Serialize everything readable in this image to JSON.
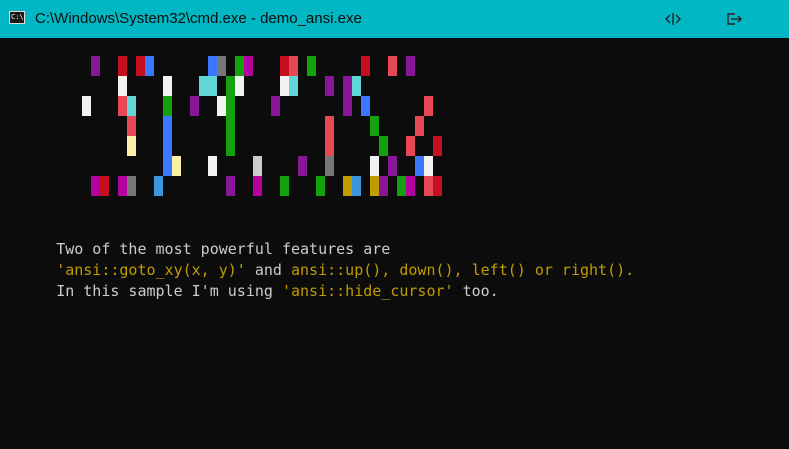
{
  "window": {
    "title": "C:\\Windows\\System32\\cmd.exe - demo_ansi.exe",
    "titlebar_color": "#00b7c3",
    "icons": [
      "cmd-app-icon",
      "resize-arrows-icon",
      "exit-icon"
    ],
    "app_icon_text": "C:\\"
  },
  "terminal": {
    "background": "#0c0c0c",
    "line1": [
      "Two of the most powerful features are"
    ],
    "line2": [
      "'ansi::goto_xy(x, y)'",
      " and ",
      "ansi::up(), down(), left() or right()."
    ],
    "line3": [
      "In this sample I'm using ",
      "'ansi::hide_cursor'",
      " too."
    ],
    "line1_colors": [
      "#cccccc"
    ],
    "line2_colors": [
      "#c19c00",
      "#cccccc",
      "#c19c00"
    ],
    "line3_colors": [
      "#cccccc",
      "#c19c00",
      "#cccccc"
    ]
  },
  "art": {
    "palette": {
      "P": "#881798",
      "R": "#c50f1f",
      "L": "#e74856",
      "B": "#3b78ff",
      "W": "#f2f2f2",
      "G": "#13a10e",
      "C": "#61d6d6",
      "Y": "#f9f1a5",
      "D": "#767676",
      "S": "#c19c00",
      "M": "#b4009e",
      "b": "#3a96dd",
      "g": "#cccccc"
    },
    "blocks": [
      {
        "row": 0,
        "col": 10,
        "color": "P"
      },
      {
        "row": 0,
        "col": 13,
        "color": "R"
      },
      {
        "row": 0,
        "col": 15,
        "color": "R"
      },
      {
        "row": 0,
        "col": 16,
        "color": "B"
      },
      {
        "row": 0,
        "col": 23,
        "color": "B"
      },
      {
        "row": 0,
        "col": 24,
        "color": "D"
      },
      {
        "row": 0,
        "col": 26,
        "color": "G"
      },
      {
        "row": 0,
        "col": 27,
        "color": "M"
      },
      {
        "row": 0,
        "col": 31,
        "color": "R"
      },
      {
        "row": 0,
        "col": 32,
        "color": "L"
      },
      {
        "row": 0,
        "col": 34,
        "color": "G"
      },
      {
        "row": 0,
        "col": 40,
        "color": "R"
      },
      {
        "row": 0,
        "col": 43,
        "color": "L"
      },
      {
        "row": 0,
        "col": 45,
        "color": "P"
      },
      {
        "row": 1,
        "col": 13,
        "color": "W"
      },
      {
        "row": 1,
        "col": 18,
        "color": "W"
      },
      {
        "row": 1,
        "col": 22,
        "color": "C"
      },
      {
        "row": 1,
        "col": 23,
        "color": "C"
      },
      {
        "row": 1,
        "col": 25,
        "color": "G"
      },
      {
        "row": 1,
        "col": 26,
        "color": "W"
      },
      {
        "row": 1,
        "col": 31,
        "color": "W"
      },
      {
        "row": 1,
        "col": 32,
        "color": "C"
      },
      {
        "row": 1,
        "col": 36,
        "color": "P"
      },
      {
        "row": 1,
        "col": 38,
        "color": "P"
      },
      {
        "row": 1,
        "col": 39,
        "color": "C"
      },
      {
        "row": 2,
        "col": 9,
        "color": "W"
      },
      {
        "row": 2,
        "col": 13,
        "color": "L"
      },
      {
        "row": 2,
        "col": 14,
        "color": "C"
      },
      {
        "row": 2,
        "col": 18,
        "color": "G"
      },
      {
        "row": 2,
        "col": 21,
        "color": "P"
      },
      {
        "row": 2,
        "col": 24,
        "color": "W"
      },
      {
        "row": 2,
        "col": 25,
        "color": "G"
      },
      {
        "row": 2,
        "col": 30,
        "color": "P"
      },
      {
        "row": 2,
        "col": 38,
        "color": "P"
      },
      {
        "row": 2,
        "col": 40,
        "color": "B"
      },
      {
        "row": 2,
        "col": 47,
        "color": "L"
      },
      {
        "row": 3,
        "col": 14,
        "color": "L"
      },
      {
        "row": 3,
        "col": 18,
        "color": "B"
      },
      {
        "row": 3,
        "col": 25,
        "color": "G"
      },
      {
        "row": 3,
        "col": 36,
        "color": "L"
      },
      {
        "row": 3,
        "col": 41,
        "color": "G"
      },
      {
        "row": 3,
        "col": 46,
        "color": "L"
      },
      {
        "row": 4,
        "col": 14,
        "color": "Y"
      },
      {
        "row": 4,
        "col": 18,
        "color": "B"
      },
      {
        "row": 4,
        "col": 25,
        "color": "G"
      },
      {
        "row": 4,
        "col": 36,
        "color": "L"
      },
      {
        "row": 4,
        "col": 42,
        "color": "G"
      },
      {
        "row": 4,
        "col": 45,
        "color": "L"
      },
      {
        "row": 4,
        "col": 48,
        "color": "R"
      },
      {
        "row": 5,
        "col": 18,
        "color": "B"
      },
      {
        "row": 5,
        "col": 19,
        "color": "Y"
      },
      {
        "row": 5,
        "col": 23,
        "color": "W"
      },
      {
        "row": 5,
        "col": 28,
        "color": "g"
      },
      {
        "row": 5,
        "col": 33,
        "color": "P"
      },
      {
        "row": 5,
        "col": 36,
        "color": "D"
      },
      {
        "row": 5,
        "col": 41,
        "color": "W"
      },
      {
        "row": 5,
        "col": 43,
        "color": "P"
      },
      {
        "row": 5,
        "col": 46,
        "color": "B"
      },
      {
        "row": 5,
        "col": 47,
        "color": "W"
      },
      {
        "row": 6,
        "col": 10,
        "color": "M"
      },
      {
        "row": 6,
        "col": 11,
        "color": "R"
      },
      {
        "row": 6,
        "col": 13,
        "color": "M"
      },
      {
        "row": 6,
        "col": 14,
        "color": "D"
      },
      {
        "row": 6,
        "col": 17,
        "color": "b"
      },
      {
        "row": 6,
        "col": 25,
        "color": "P"
      },
      {
        "row": 6,
        "col": 28,
        "color": "M"
      },
      {
        "row": 6,
        "col": 31,
        "color": "G"
      },
      {
        "row": 6,
        "col": 35,
        "color": "G"
      },
      {
        "row": 6,
        "col": 38,
        "color": "S"
      },
      {
        "row": 6,
        "col": 39,
        "color": "b"
      },
      {
        "row": 6,
        "col": 41,
        "color": "S"
      },
      {
        "row": 6,
        "col": 42,
        "color": "P"
      },
      {
        "row": 6,
        "col": 44,
        "color": "G"
      },
      {
        "row": 6,
        "col": 45,
        "color": "M"
      },
      {
        "row": 6,
        "col": 47,
        "color": "L"
      },
      {
        "row": 6,
        "col": 48,
        "color": "R"
      }
    ]
  }
}
